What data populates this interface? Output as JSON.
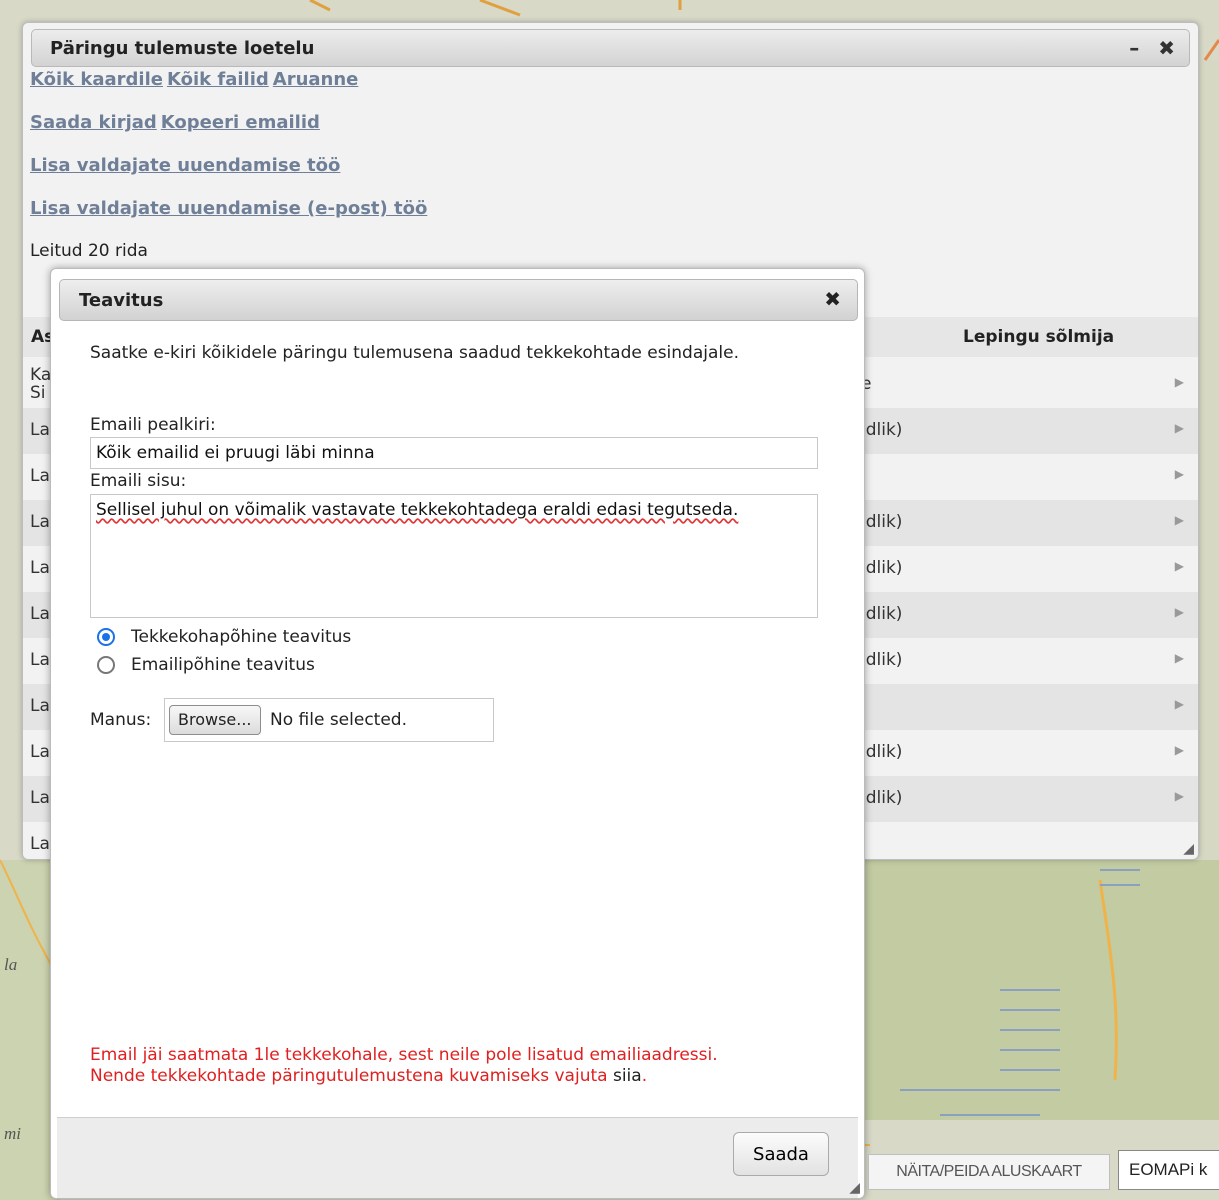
{
  "results_window": {
    "title": "Päringu tulemuste loetelu",
    "minimize_icon": "–",
    "close_icon": "✖",
    "links": {
      "all_to_map": "Kõik kaardile",
      "all_files": "Kõik failid",
      "report": "Aruanne",
      "send_letters": "Saada kirjad",
      "copy_emails": "Kopeeri emailid",
      "add_holder_update_job": "Lisa valdajate uuendamise töö",
      "add_holder_update_email_job": "Lisa valdajate uuendamise (e-post) töö"
    },
    "found_text": "Leitud 20 rida",
    "table": {
      "col_left": "As",
      "col_right": "Lepingu sõlmija",
      "rows": [
        {
          "left": "Ka",
          "left2": "Si",
          "right": "e"
        },
        {
          "left": "La",
          "right": "ıdlik)"
        },
        {
          "left": "La",
          "right": ""
        },
        {
          "left": "La",
          "right": "ıdlik)"
        },
        {
          "left": "La",
          "right": "ıdlik)"
        },
        {
          "left": "La",
          "right": "ıdlik)"
        },
        {
          "left": "La",
          "right": "ıdlik)"
        },
        {
          "left": "La",
          "right": ""
        },
        {
          "left": "La",
          "right": "ıdlik)"
        },
        {
          "left": "La",
          "right": "ıdlik)"
        },
        {
          "left": "La",
          "right": ""
        }
      ]
    }
  },
  "dialog": {
    "title": "Teavitus",
    "close_icon": "✖",
    "intro": "Saatke e-kiri kõikidele päringu tulemusena saadud tekkekohtade esindajale.",
    "subject_label": "Emaili pealkiri:",
    "subject_value": "Kõik emailid ei pruugi läbi minna",
    "body_label": "Emaili sisu:",
    "body_value": "Sellisel juhul on võimalik vastavate tekkekohtadega eraldi edasi tegutseda.",
    "radio_options": [
      {
        "label": "Tekkekohapõhine teavitus",
        "selected": true
      },
      {
        "label": "Emailipõhine teavitus",
        "selected": false
      }
    ],
    "attachment_label": "Manus:",
    "browse_label": "Browse...",
    "file_status": "No file selected.",
    "warning_line1": "Email jäi saatmata 1le tekkekohale, sest neile pole lisatud emailiaadressi.",
    "warning_line2_prefix": "Nende tekkekohtade päringutulemustena kuvamiseks vajuta ",
    "warning_link": "siia",
    "warning_suffix": ".",
    "send_label": "Saada"
  },
  "bottom_bar": {
    "basemap_toggle": "NÄITA/PEIDA ALUSKAART",
    "eomap_tab": "EOMAPi k"
  },
  "map_labels": {
    "label_a": "la",
    "label_b": "mi"
  },
  "colors": {
    "link": "#6f7f97",
    "warning": "#e02020",
    "radio_accent": "#1a73e8",
    "map_green": "#c2cba2",
    "map_road": "#f0b34a"
  }
}
